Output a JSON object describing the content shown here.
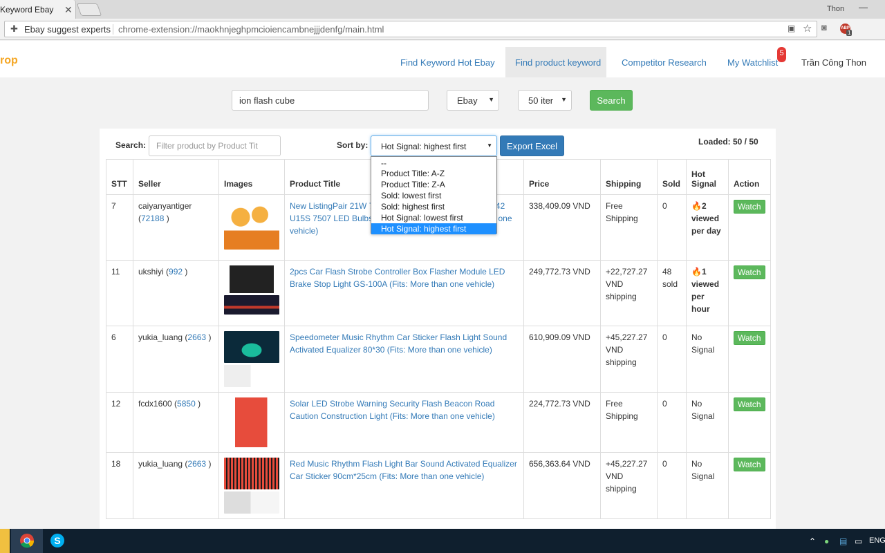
{
  "browser": {
    "tab_title": "Keyword Ebay",
    "profile_name": "Thon",
    "site_name": "Ebay suggest experts",
    "url": "chrome-extension://maokhnjeghpmcioiencambnejjjdenfg/main.html",
    "abp_count": "1"
  },
  "nav": {
    "brand": "rop",
    "links": [
      "Find Keyword Hot Ebay",
      "Find product keyword",
      "Competitor Research",
      "My Watchlist"
    ],
    "watchlist_badge": "5",
    "user": "Trần Công Thon"
  },
  "search": {
    "keyword": "ion flash cube",
    "marketplace": "Ebay",
    "items": "50 iter",
    "button": "Search"
  },
  "panel": {
    "search_label": "Search:",
    "filter_placeholder": "Filter product by Product Tit",
    "sort_label": "Sort by:",
    "sort_selected": "Hot Signal: highest first",
    "export_button": "Export Excel",
    "loaded": "Loaded: 50 / 50",
    "sort_options": [
      "--",
      "Product Title: A-Z",
      "Product Title: Z-A",
      "Sold: lowest first",
      "Sold: highest first",
      "Hot Signal: lowest first",
      "Hot Signal: highest first"
    ]
  },
  "table": {
    "headers": {
      "stt": "STT",
      "seller": "Seller",
      "images": "Images",
      "title": "Product Title",
      "price": "Price",
      "shipping": "Shipping",
      "sold": "Sold",
      "hot_signal": "Hot Signal",
      "action": "Action"
    },
    "rows": [
      {
        "stt": "7",
        "seller": "caiyanyantiger",
        "feedback": "72188",
        "title": "New ListingPair 21W 7443 7440 T20 W21W 3030 SMD 42 U15S 7507 LED Bulbs Car Flash Lights (Fits: More than one vehicle)",
        "price": "338,409.09 VND",
        "shipping": "Free Shipping",
        "sold": "0",
        "hot": "2 viewed per day",
        "hot_flag": true,
        "action": "Watch"
      },
      {
        "stt": "11",
        "seller": "ukshiyi",
        "feedback": "992",
        "title": "2pcs Car Flash Strobe Controller Box Flasher Module LED Brake Stop Light GS-100A (Fits: More than one vehicle)",
        "price": "249,772.73 VND",
        "shipping": "+22,727.27 VND shipping",
        "sold": "48 sold",
        "hot": "1 viewed per hour",
        "hot_flag": true,
        "action": "Watch"
      },
      {
        "stt": "6",
        "seller": "yukia_luang",
        "feedback": "2663",
        "title": "Speedometer Music Rhythm Car Sticker Flash Light Sound Activated Equalizer 80*30 (Fits: More than one vehicle)",
        "price": "610,909.09 VND",
        "shipping": "+45,227.27 VND shipping",
        "sold": "0",
        "hot": "No Signal",
        "hot_flag": false,
        "action": "Watch"
      },
      {
        "stt": "12",
        "seller": "fcdx1600",
        "feedback": "5850",
        "title": "Solar LED Strobe Warning Security Flash Beacon Road Caution Construction Light (Fits: More than one vehicle)",
        "price": "224,772.73 VND",
        "shipping": "Free Shipping",
        "sold": "0",
        "hot": "No Signal",
        "hot_flag": false,
        "action": "Watch"
      },
      {
        "stt": "18",
        "seller": "yukia_luang",
        "feedback": "2663",
        "title": "Red Music Rhythm Flash Light Bar Sound Activated Equalizer Car Sticker 90cm*25cm (Fits: More than one vehicle)",
        "price": "656,363.64 VND",
        "shipping": "+45,227.27 VND shipping",
        "sold": "0",
        "hot": "No Signal",
        "hot_flag": false,
        "action": "Watch"
      }
    ]
  },
  "taskbar": {
    "language": "ENG"
  },
  "icons": {
    "puzzle": "puzzle-icon",
    "translate": "translate-icon",
    "star": "star-icon",
    "camera": "camera-icon",
    "flame": "flame-icon",
    "chrome": "chrome-icon",
    "skype": "skype-icon"
  }
}
